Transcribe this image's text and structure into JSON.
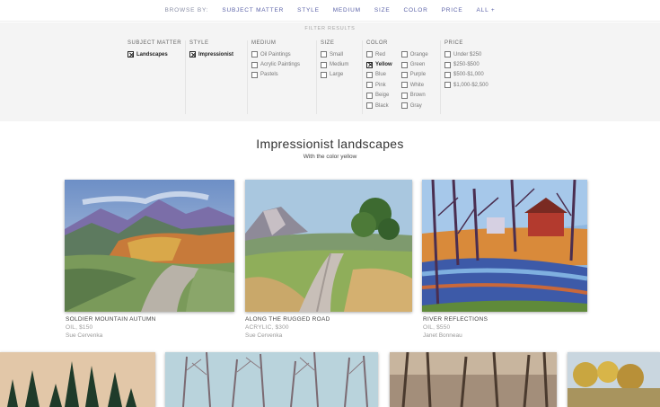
{
  "nav": {
    "label": "BROWSE BY:",
    "items": [
      "SUBJECT MATTER",
      "STYLE",
      "MEDIUM",
      "SIZE",
      "COLOR",
      "PRICE",
      "ALL +"
    ]
  },
  "filters": {
    "title": "FILTER RESULTS",
    "subject": {
      "title": "SUBJECT MATTER",
      "options": [
        "Landscapes"
      ]
    },
    "style": {
      "title": "STYLE",
      "options": [
        "Impressionist"
      ]
    },
    "medium": {
      "title": "MEDIUM",
      "options": [
        "Oil Paintings",
        "Acrylic Paintings",
        "Pastels"
      ]
    },
    "size": {
      "title": "SIZE",
      "options": [
        "Small",
        "Medium",
        "Large"
      ]
    },
    "color": {
      "title": "COLOR",
      "col1": [
        "Red",
        "Yellow",
        "Blue",
        "Pink",
        "Beige",
        "Black"
      ],
      "col2": [
        "Orange",
        "Green",
        "Purple",
        "White",
        "Brown",
        "Gray"
      ]
    },
    "price": {
      "title": "PRICE",
      "options": [
        "Under $250",
        "$250-$500",
        "$500-$1,000",
        "$1,000-$2,500"
      ]
    }
  },
  "heading": "Impressionist landscapes",
  "subheading": "With the color yellow",
  "artworks": [
    {
      "title": "SOLDIER MOUNTAIN AUTUMN",
      "medium": "OIL, $150",
      "artist": "Sue Cervenka"
    },
    {
      "title": "ALONG THE RUGGED ROAD",
      "medium": "ACRYLIC, $300",
      "artist": "Sue Cervenka"
    },
    {
      "title": "RIVER REFLECTIONS",
      "medium": "OIL, $550",
      "artist": "Janet Bonneau"
    }
  ],
  "colors": {
    "accent": "#5c63a8",
    "panel": "#f4f4f4"
  }
}
